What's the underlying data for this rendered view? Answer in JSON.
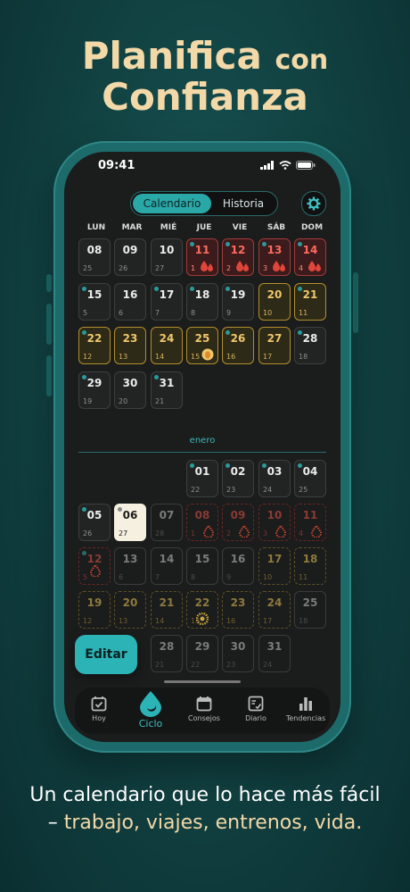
{
  "headline": {
    "line1_big": "Planifica",
    "line1_small": "con",
    "line2": "Confianza"
  },
  "status": {
    "time": "09:41"
  },
  "segment": {
    "calendar": "Calendario",
    "history": "Historia"
  },
  "weekdays": [
    "LUN",
    "MAR",
    "MIÉ",
    "JUE",
    "VIE",
    "SÁB",
    "DOM"
  ],
  "month_label": "enero",
  "editar": "Editar",
  "tabs": [
    {
      "label": "Hoy"
    },
    {
      "label": "Ciclo"
    },
    {
      "label": "Consejos"
    },
    {
      "label": "Diario"
    },
    {
      "label": "Tendencias"
    }
  ],
  "subline": {
    "l1": "Un calendario que lo hace más fácil",
    "dash": "– ",
    "l2": "trabajo, viajes, entrenos, vida."
  },
  "colors": {
    "accent": "#2bb3b6",
    "period": "#e0453a",
    "fertile": "#efc76a",
    "headline": "#f3d9a8"
  }
}
